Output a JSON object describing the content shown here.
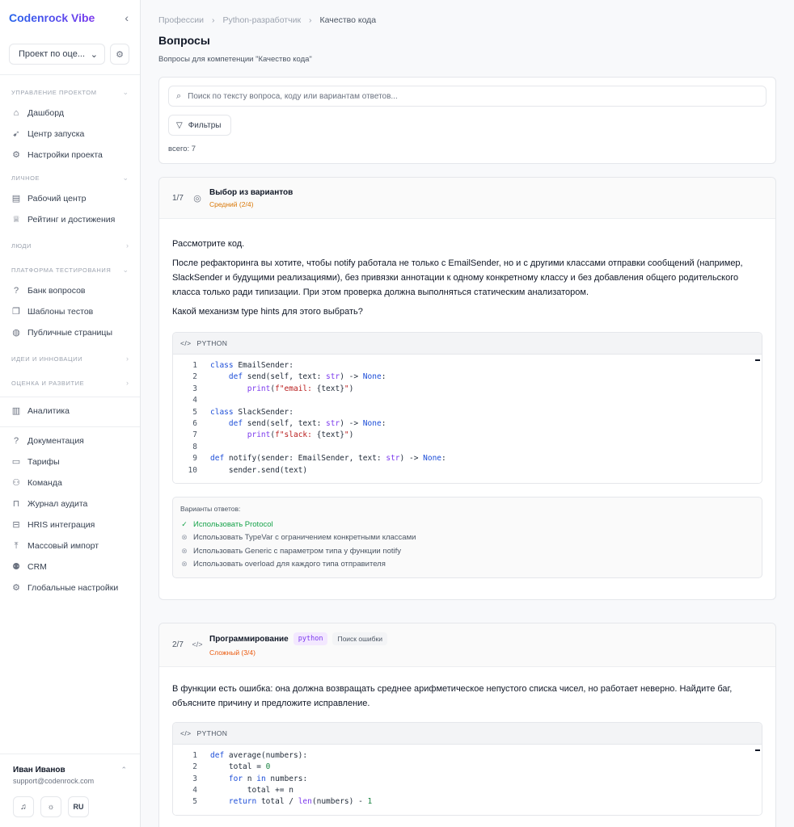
{
  "brand": "Codenrock Vibe",
  "project_select": "Проект по оце...",
  "nav": {
    "sections": [
      {
        "title": "Управление проектом",
        "items": [
          "Дашборд",
          "Центр запуска",
          "Настройки проекта"
        ]
      },
      {
        "title": "Личное",
        "items": [
          "Рабочий центр",
          "Рейтинг и достижения"
        ]
      },
      {
        "title": "Люди"
      },
      {
        "title": "Платформа тестирования",
        "items": [
          "Банк вопросов",
          "Шаблоны тестов",
          "Публичные страницы"
        ]
      },
      {
        "title": "Идеи и инновации"
      },
      {
        "title": "Оценка и развитие"
      }
    ],
    "analytics": "Аналитика",
    "bottom_items": [
      "Документация",
      "Тарифы",
      "Команда",
      "Журнал аудита",
      "HRIS интеграция",
      "Массовый импорт",
      "CRM",
      "Глобальные настройки"
    ]
  },
  "user": {
    "name": "Иван Иванов",
    "email": "support@codenrock.com",
    "lang": "RU"
  },
  "breadcrumbs": [
    "Профессии",
    "Python-разработчик",
    "Качество кода"
  ],
  "page": {
    "title": "Вопросы",
    "subtitle": "Вопросы для компетенции \"Качество кода\""
  },
  "search": {
    "placeholder": "Поиск по тексту вопроса, коду или вариантам ответов..."
  },
  "filters_label": "Фильтры",
  "total_label": "всего: 7",
  "questions": [
    {
      "num": "1/7",
      "type": "Выбор из вариантов",
      "difficulty": "Средний (2/4)",
      "paragraphs": [
        "Рассмотрите код.",
        "После рефакторинга вы хотите, чтобы notify работала не только с EmailSender, но и с другими классами отправки сообщений (например, SlackSender и будущими реализациями), без привязки аннотации к одному конкретному классу и без добавления общего родительского класса только ради типизации. При этом проверка должна выполняться статическим анализатором.",
        "Какой механизм type hints для этого выбрать?"
      ],
      "code_lang": "PYTHON",
      "answers_title": "Варианты ответов:",
      "answers": [
        "Использовать Protocol",
        "Использовать TypeVar с ограничением конкретными классами",
        "Использовать Generic с параметром типа у функции notify",
        "Использовать overload для каждого типа отправителя"
      ]
    },
    {
      "num": "2/7",
      "type": "Программирование",
      "tag_lang": "python",
      "tag_kind": "Поиск ошибки",
      "difficulty": "Сложный (3/4)",
      "paragraphs": [
        "В функции есть ошибка: она должна возвращать среднее арифметическое непустого списка чисел, но работает неверно. Найдите баг, объясните причину и предложите исправление."
      ],
      "code_lang": "PYTHON"
    }
  ]
}
